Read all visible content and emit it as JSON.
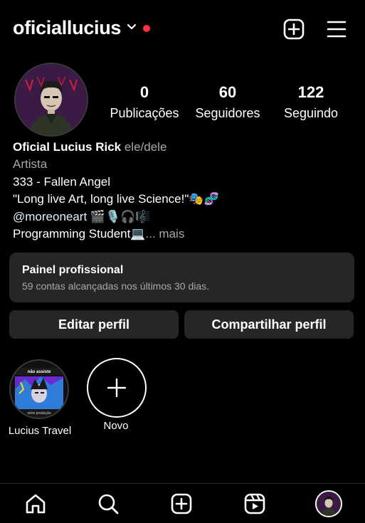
{
  "header": {
    "username": "oficiallucius",
    "icons": [
      "chevron-down-icon",
      "notification-dot",
      "plus-square-icon",
      "menu-icon"
    ]
  },
  "stats": {
    "posts": {
      "value": "0",
      "label": "Publicações"
    },
    "followers": {
      "value": "60",
      "label": "Seguidores"
    },
    "following": {
      "value": "122",
      "label": "Seguindo"
    }
  },
  "bio": {
    "name": "Oficial Lucius Rick",
    "pronouns": "ele/dele",
    "category": "Artista",
    "line1": "333 - Fallen Angel",
    "line2": "\"Long live Art, long live Science!\"🎭🧬",
    "mention": "@moreoneart",
    "mention_emojis": " 🎬🎙️🎧🎼",
    "line4": "Programming Student💻",
    "more": "... mais"
  },
  "dashboard": {
    "title": "Painel profissional",
    "subtitle": "59 contas alcançadas nos últimos 30 dias."
  },
  "buttons": {
    "edit": "Editar perfil",
    "share": "Compartilhar perfil"
  },
  "highlights": [
    {
      "label": "Lucius Travel",
      "cover_top_text": "não assiste",
      "cover_bottom_text": "série produção"
    },
    {
      "label": "Novo"
    }
  ],
  "bottom_nav": [
    "home-icon",
    "search-icon",
    "create-icon",
    "reels-icon",
    "profile-avatar"
  ],
  "colors": {
    "background": "#000000",
    "surface": "#262626",
    "muted": "#a8a8a8",
    "notification": "#ff3040"
  }
}
